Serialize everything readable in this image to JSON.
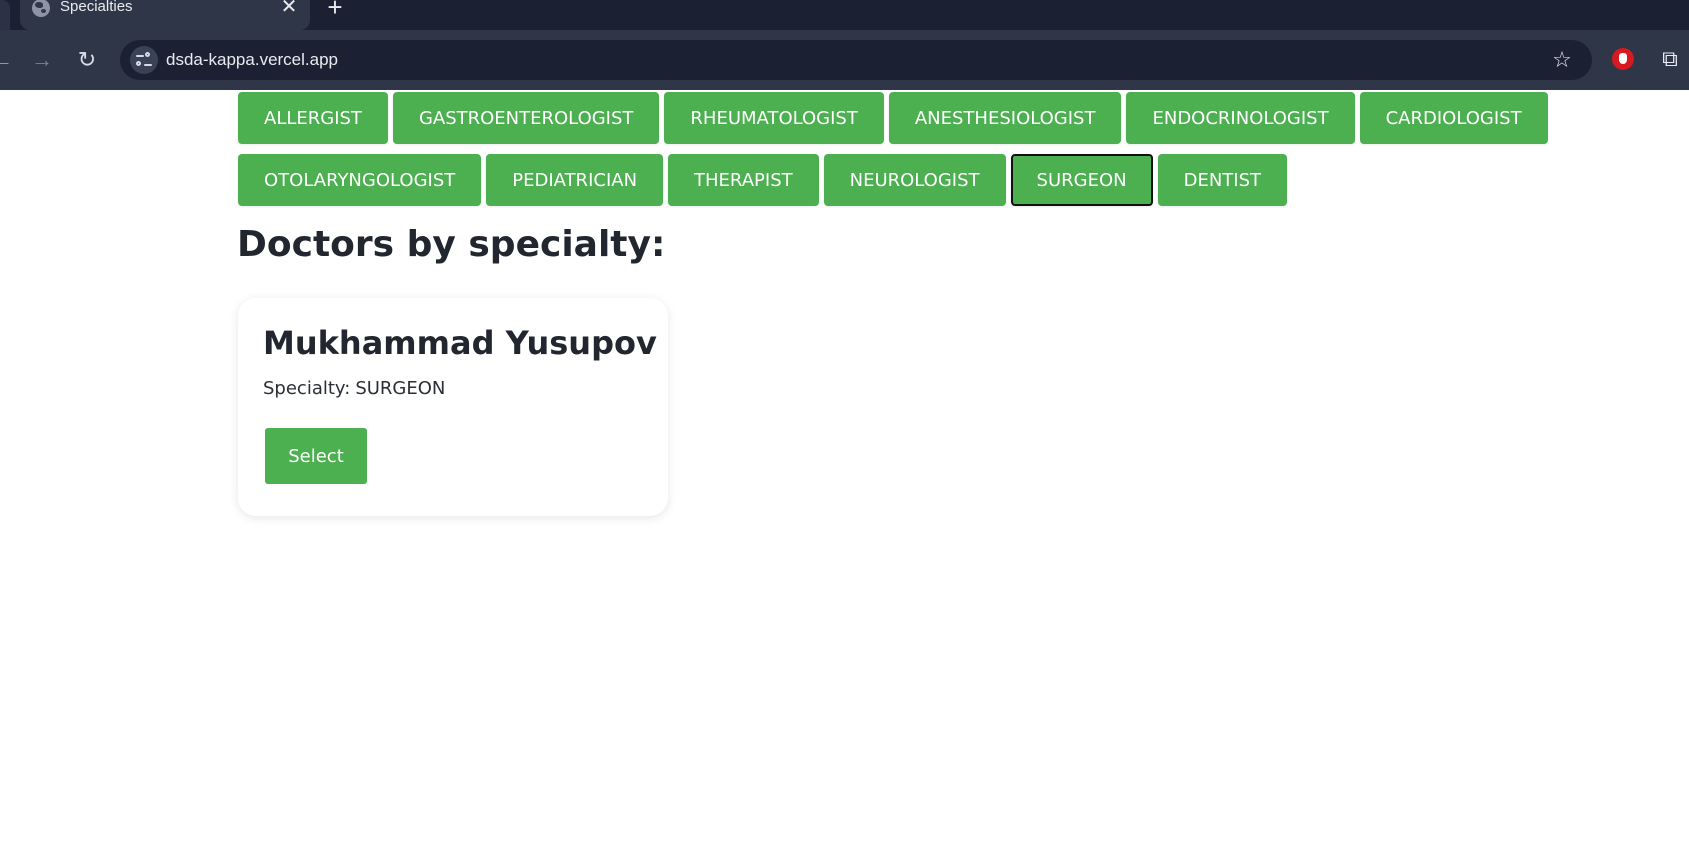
{
  "browser": {
    "tab_title": "Specialties",
    "tab_close_glyph": "✕",
    "new_tab_glyph": "+",
    "url": "dsda-kappa.vercel.app",
    "icons": [
      "globe-icon",
      "close-icon",
      "plus-icon",
      "back-icon",
      "forward-icon",
      "reload-icon",
      "site-info-icon",
      "star-icon",
      "adblock-extension-icon",
      "extensions-puzzle-icon"
    ]
  },
  "specialties": {
    "row1": [
      "ALLERGIST",
      "GASTROENTEROLOGIST",
      "RHEUMATOLOGIST",
      "ANESTHESIOLOGIST",
      "ENDOCRINOLOGIST",
      "CARDIOLOGIST"
    ],
    "row2": [
      "OTOLARYNGOLOGIST",
      "PEDIATRICIAN",
      "THERAPIST",
      "NEUROLOGIST",
      "SURGEON",
      "DENTIST"
    ],
    "selected": "SURGEON"
  },
  "main": {
    "heading": "Doctors by specialty:",
    "doctors": [
      {
        "name": "Mukhammad Yusupov",
        "specialty_label": "Specialty:",
        "specialty_value": "SURGEON",
        "select_label": "Select"
      }
    ]
  },
  "colors": {
    "accent_green": "#4caf50",
    "chrome_dark": "#1b2133",
    "chrome_toolbar": "#2f3648",
    "text_dark": "#22262e"
  }
}
